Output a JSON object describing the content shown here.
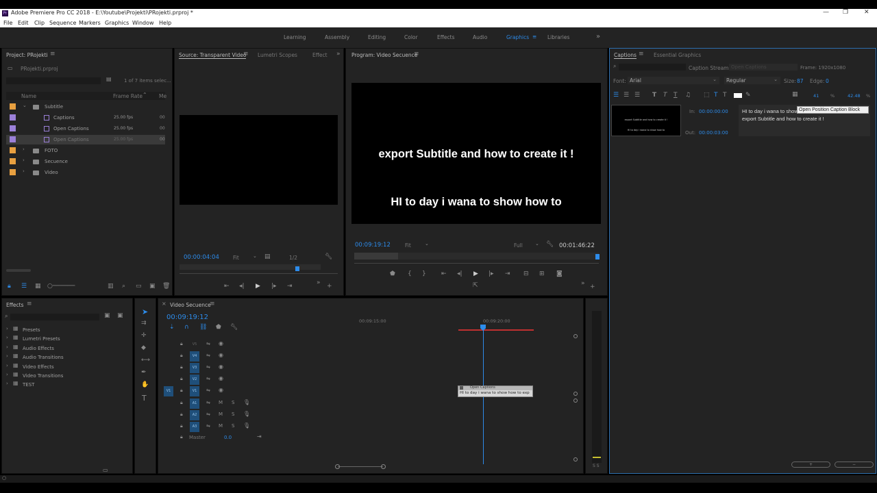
{
  "window": {
    "title": "Adobe Premiere Pro CC 2018 - E:\\Youtube\\Projekti\\PRojekti.prproj *",
    "min": "—",
    "max": "❐",
    "close": "✕"
  },
  "menu": [
    "File",
    "Edit",
    "Clip",
    "Sequence",
    "Markers",
    "Graphics",
    "Window",
    "Help"
  ],
  "workspaces": [
    "Learning",
    "Assembly",
    "Editing",
    "Color",
    "Effects",
    "Audio",
    "Graphics",
    "Libraries"
  ],
  "workspace_active": "Graphics",
  "project": {
    "title": "Project: PRojekti",
    "file": "PRojekti.prproj",
    "selection": "1 of 7 items selec...",
    "col_name": "Name",
    "col_framerate": "Frame Rate",
    "col_me": "Me",
    "items": [
      {
        "name": "Subtitle",
        "rate": "",
        "extra": "",
        "color": "#e8a040",
        "type": "folder",
        "indent": 0
      },
      {
        "name": "Captions",
        "rate": "25.00 fps",
        "extra": "00",
        "color": "#9b80d8",
        "type": "clip",
        "indent": 1
      },
      {
        "name": "Open Captions",
        "rate": "25.00 fps",
        "extra": "00",
        "color": "#9b80d8",
        "type": "clip",
        "indent": 1
      },
      {
        "name": "Open Captions",
        "rate": "25.00 fps",
        "extra": "00",
        "color": "#9b80d8",
        "type": "clip",
        "indent": 1
      },
      {
        "name": "FOTO",
        "rate": "",
        "extra": "",
        "color": "#e8a040",
        "type": "folder",
        "indent": 0
      },
      {
        "name": "Secuence",
        "rate": "",
        "extra": "",
        "color": "#e8a040",
        "type": "folder",
        "indent": 0
      },
      {
        "name": "Video",
        "rate": "",
        "extra": "",
        "color": "#e8a040",
        "type": "folder",
        "indent": 0
      }
    ]
  },
  "source": {
    "tabs": [
      "Source: Transparent Video",
      "Lumetri Scopes",
      "Effect"
    ],
    "timecode": "00:00:04:04",
    "fit": "Fit",
    "res": "1/2"
  },
  "program": {
    "title": "Program: Video Secuence",
    "line1": "export Subtitle and how to create it !",
    "line2": "HI to day i wana to show how to",
    "timecode": "00:09:19:12",
    "fit": "Fit",
    "res": "Full",
    "duration": "00:01:46:22"
  },
  "captions": {
    "tabs": [
      "Captions",
      "Essential Graphics"
    ],
    "stream_label": "Caption Stream:",
    "stream_value": "Open Captions",
    "frame": "Frame: 1920x1080",
    "font_label": "Font:",
    "font_value": "Arial",
    "style_value": "Regular",
    "size_label": "Size:",
    "size_value": "87",
    "edge_label": "Edge:",
    "edge_value": "0",
    "x_value": "41",
    "pct": "%",
    "y_value": "42.48",
    "in_label": "In:",
    "in_value": "00:00:00:00",
    "out_label": "Out:",
    "out_value": "00:00:03:00",
    "text": "HI to day i wana to show how to\nexport Subtitle and how to create it !",
    "tooltip": "Open Position Caption Block",
    "thumb_line1": "export Subtitle and how to create it !",
    "thumb_line2": "HI to day i wana to show how to"
  },
  "effects": {
    "title": "Effects",
    "items": [
      "Presets",
      "Lumetri Presets",
      "Audio Effects",
      "Audio Transitions",
      "Video Effects",
      "Video Transitions",
      "TEST"
    ]
  },
  "timeline": {
    "title": "Video Secuence",
    "timecode": "00:09:19:12",
    "ruler": [
      "00:09:15:00",
      "00:09:20:00"
    ],
    "video_tracks": [
      "V5",
      "V4",
      "V3",
      "V2",
      "V1"
    ],
    "audio_tracks": [
      "A1",
      "A2",
      "A3"
    ],
    "master": "Master",
    "master_val": "0.0",
    "clip_title": "Open Captions",
    "clip_text": "HI to day i wana to show how to  exp",
    "meter": "S S"
  }
}
